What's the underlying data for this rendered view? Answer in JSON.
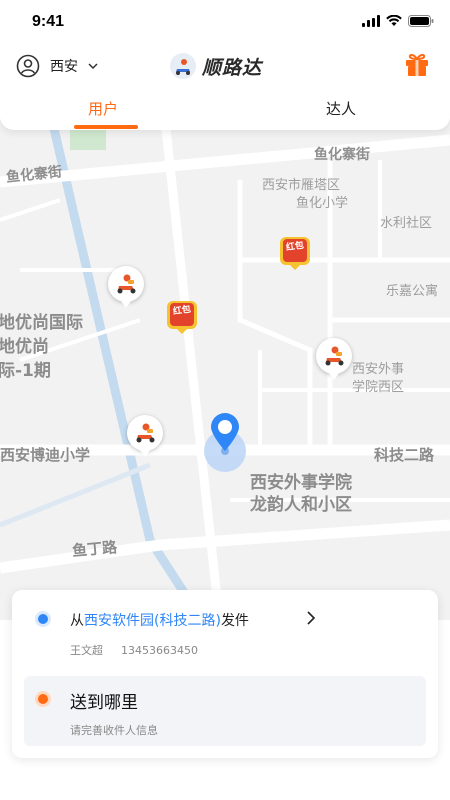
{
  "status_bar": {
    "time": "9:41"
  },
  "header": {
    "city": "西安",
    "brand_name": "顺路达",
    "tabs": [
      {
        "label": "用户",
        "active": true
      },
      {
        "label": "达人",
        "active": false
      }
    ]
  },
  "map": {
    "labels": [
      "鱼化寨街",
      "鱼化寨街",
      "西安市雁塔区",
      "鱼化小学",
      "水利社区",
      "乐嘉公寓",
      "地优尚国际",
      "地优尚",
      "际-1期",
      "西安外事",
      "学院西区",
      "西安博迪小学",
      "科技二路",
      "西安外事学院",
      "龙韵人和小区",
      "鱼丁路"
    ],
    "red_packet_text": "红包"
  },
  "order": {
    "from_prefix": "从",
    "from_place": "西安软件园(科技二路)",
    "from_suffix": "发件",
    "sender_name": "王文超",
    "sender_phone": "13453663450",
    "dest_title": "送到哪里",
    "dest_hint": "请完善收件人信息"
  },
  "colors": {
    "accent": "#ff6a13",
    "link_blue": "#2f86f6",
    "map_bg": "#f2f2f2"
  },
  "icons": {
    "location": "user-circle-icon",
    "dropdown": "chevron-down-icon",
    "gift": "gift-icon",
    "from_arrow": "chevron-right-icon"
  }
}
